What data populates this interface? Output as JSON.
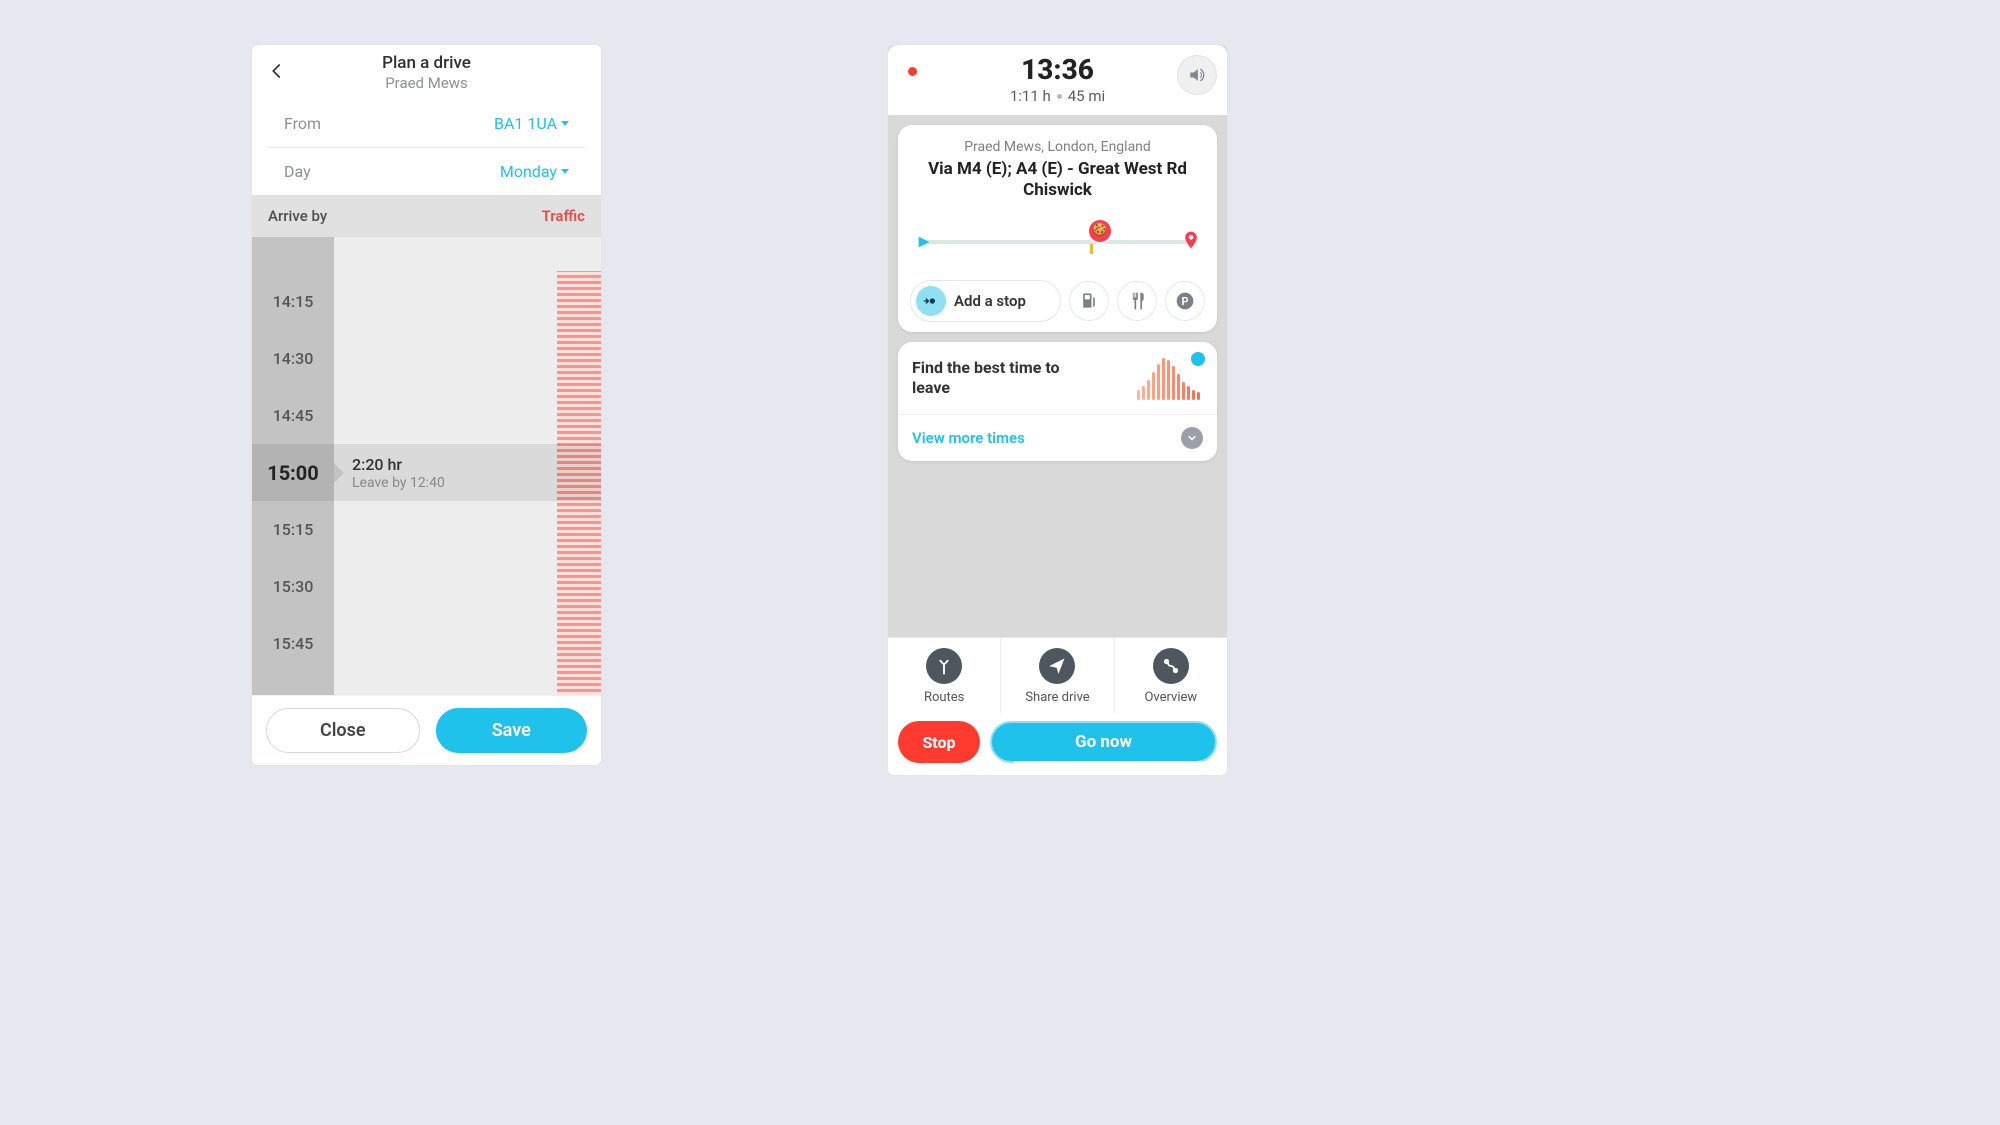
{
  "left": {
    "title": "Plan a drive",
    "subtitle": "Praed Mews",
    "from_label": "From",
    "from_value": "BA1 1UA",
    "day_label": "Day",
    "day_value": "Monday",
    "arrive_label": "Arrive by",
    "traffic_label": "Traffic",
    "times": [
      "14:15",
      "14:30",
      "14:45",
      "15:00",
      "15:15",
      "15:30",
      "15:45"
    ],
    "selected_index": 3,
    "selected_duration": "2:20 hr",
    "selected_leave": "Leave by 12:40",
    "close_btn": "Close",
    "save_btn": "Save"
  },
  "right": {
    "clock": "13:36",
    "eta_dur": "1:11 h",
    "eta_dist": "45 mi",
    "dest_sub": "Praed Mews, London, England",
    "dest_main": "Via M4 (E); A4 (E) - Great West Rd Chiswick",
    "addstop": "Add a stop",
    "best_time": "Find the best time to leave",
    "view_more": "View more times",
    "routes": "Routes",
    "share": "Share drive",
    "overview": "Overview",
    "stop": "Stop",
    "go": "Go now"
  }
}
